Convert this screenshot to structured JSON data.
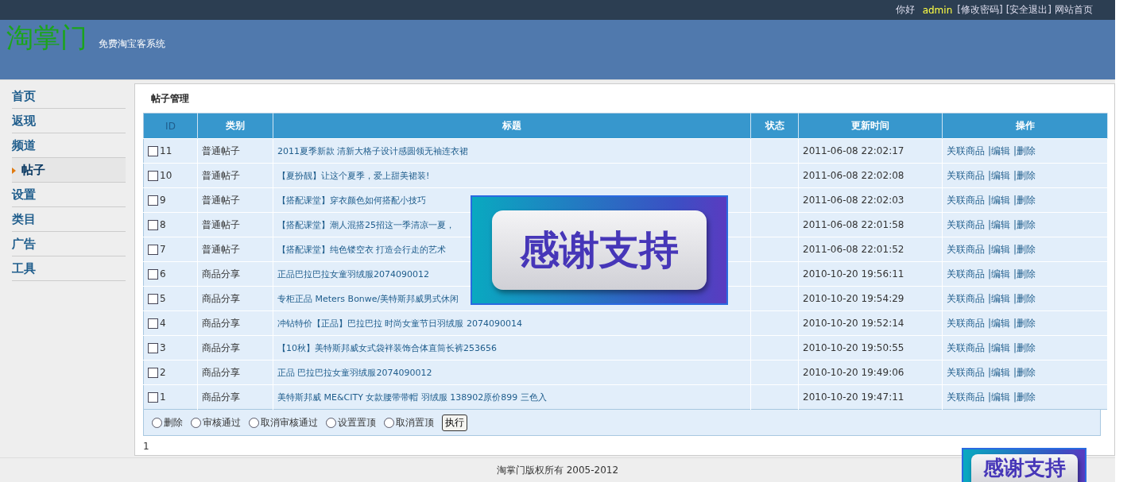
{
  "top_bar": {
    "greeting": "你好",
    "user": "admin",
    "links": [
      "[修改密码]",
      "[安全退出]",
      "网站首页"
    ]
  },
  "header": {
    "logo": "淘掌门",
    "tagline": "免费淘宝客系统"
  },
  "sidebar": {
    "items": [
      {
        "label": "首页",
        "selected": false
      },
      {
        "label": "返现",
        "selected": false
      },
      {
        "label": "频道",
        "selected": false
      },
      {
        "label": "帖子",
        "selected": true
      },
      {
        "label": "设置",
        "selected": false
      },
      {
        "label": "类目",
        "selected": false
      },
      {
        "label": "广告",
        "selected": false
      },
      {
        "label": "工具",
        "selected": false
      }
    ]
  },
  "panel": {
    "title": "帖子管理"
  },
  "table": {
    "columns": [
      "ID",
      "类别",
      "标题",
      "状态",
      "更新时间",
      "操作"
    ],
    "rows": [
      {
        "checked": false,
        "id": "11",
        "category": "普通帖子",
        "title": "2011夏季新款 清新大格子设计感圆领无袖连衣裙",
        "time": "2011-06-08 22:02:17",
        "actions": [
          "关联商品",
          "|编辑",
          "|删除"
        ]
      },
      {
        "checked": false,
        "id": "10",
        "category": "普通帖子",
        "title": "【夏扮靓】让这个夏季，爱上甜美裙装!",
        "time": "2011-06-08 22:02:08",
        "actions": [
          "关联商品",
          "|编辑",
          "|删除"
        ]
      },
      {
        "checked": false,
        "id": "9",
        "category": "普通帖子",
        "title": "【搭配课堂】穿衣颜色如何搭配小技巧",
        "time": "2011-06-08 22:02:03",
        "actions": [
          "关联商品",
          "|编辑",
          "|删除"
        ]
      },
      {
        "checked": false,
        "id": "8",
        "category": "普通帖子",
        "title": "【搭配课堂】潮人混搭25招这一季清凉一夏，",
        "time": "2011-06-08 22:01:58",
        "actions": [
          "关联商品",
          "|编辑",
          "|删除"
        ]
      },
      {
        "checked": false,
        "id": "7",
        "category": "普通帖子",
        "title": "【搭配课堂】纯色镂空衣 打造会行走的艺术",
        "time": "2011-06-08 22:01:52",
        "actions": [
          "关联商品",
          "|编辑",
          "|删除"
        ]
      },
      {
        "checked": false,
        "id": "6",
        "category": "商品分享",
        "title": "正品巴拉巴拉女童羽绒服2074090012",
        "time": "2010-10-20 19:56:11",
        "actions": [
          "关联商品",
          "|编辑",
          "|删除"
        ]
      },
      {
        "checked": false,
        "id": "5",
        "category": "商品分享",
        "title": "专柜正品 Meters Bonwe/美特斯邦威男式休闲",
        "time": "2010-10-20 19:54:29",
        "actions": [
          "关联商品",
          "|编辑",
          "|删除"
        ]
      },
      {
        "checked": false,
        "id": "4",
        "category": "商品分享",
        "title": "冲钻特价【正品】巴拉巴拉 时尚女童节日羽绒服 2074090014",
        "time": "2010-10-20 19:52:14",
        "actions": [
          "关联商品",
          "|编辑",
          "|删除"
        ]
      },
      {
        "checked": false,
        "id": "3",
        "category": "商品分享",
        "title": "【10秋】美特斯邦威女式袋袢装饰合体直筒长裤253656",
        "time": "2010-10-20 19:50:55",
        "actions": [
          "关联商品",
          "|编辑",
          "|删除"
        ]
      },
      {
        "checked": false,
        "id": "2",
        "category": "商品分享",
        "title": "正品 巴拉巴拉女童羽绒服2074090012",
        "time": "2010-10-20 19:49:06",
        "actions": [
          "关联商品",
          "|编辑",
          "|删除"
        ]
      },
      {
        "checked": false,
        "id": "1",
        "category": "商品分享",
        "title": "美特斯邦威 ME&CITY 女款腰带带帽 羽绒服 138902原价899 三色入",
        "time": "2010-10-20 19:47:11",
        "actions": [
          "关联商品",
          "|编辑",
          "|删除"
        ]
      }
    ]
  },
  "batch": {
    "options": [
      {
        "label": "删除",
        "selected": false
      },
      {
        "label": "审核通过",
        "selected": false
      },
      {
        "label": "取消审核通过",
        "selected": false
      },
      {
        "label": "设置置顶",
        "selected": false
      },
      {
        "label": "取消置顶",
        "selected": false
      }
    ],
    "button": "执行"
  },
  "pagination": "1",
  "footer": "淘掌门版权所有  2005-2012",
  "ads": [
    {
      "text": "感谢支持"
    },
    {
      "text": "感谢支持"
    }
  ]
}
